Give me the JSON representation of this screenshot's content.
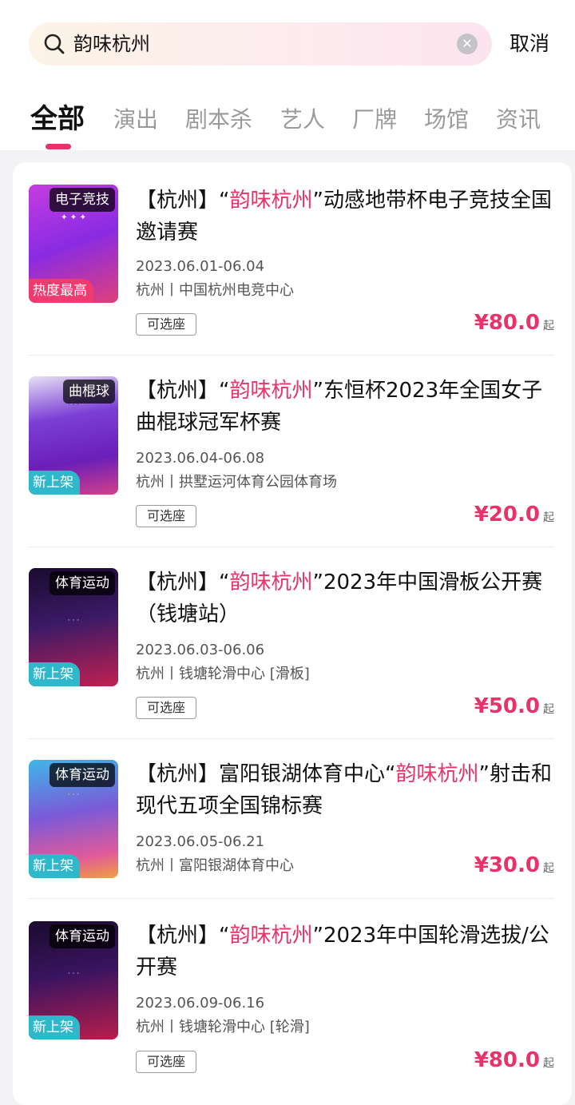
{
  "search": {
    "query": "韵味杭州",
    "cancel_label": "取消"
  },
  "tabs": [
    "全部",
    "演出",
    "剧本杀",
    "艺人",
    "厂牌",
    "场馆",
    "资讯"
  ],
  "colors": {
    "accent": "#e8326a",
    "hot_badge": "#ef3b6f",
    "new_badge": "#2fb8c9"
  },
  "results": [
    {
      "tag": "电子竞技",
      "badge": "热度最高",
      "title_pre": "【杭州】“",
      "title_hl": "韵味杭州",
      "title_post": "”动感地带杯电子竞技全国邀请赛",
      "date": "2023.06.01-06.04",
      "venue": "杭州丨中国杭州电竞中心",
      "seat_label": "可选座",
      "price": "¥80.0",
      "price_suffix": "起"
    },
    {
      "tag": "曲棍球",
      "badge": "新上架",
      "title_pre": "【杭州】“",
      "title_hl": "韵味杭州",
      "title_post": "”东恒杯2023年全国女子曲棍球冠军杯赛",
      "date": "2023.06.04-06.08",
      "venue": "杭州丨拱墅运河体育公园体育场",
      "seat_label": "可选座",
      "price": "¥20.0",
      "price_suffix": "起"
    },
    {
      "tag": "体育运动",
      "badge": "新上架",
      "title_pre": "【杭州】“",
      "title_hl": "韵味杭州",
      "title_post": "”2023年中国滑板公开赛（钱塘站）",
      "date": "2023.06.03-06.06",
      "venue": "杭州丨钱塘轮滑中心 [滑板]",
      "seat_label": "可选座",
      "price": "¥50.0",
      "price_suffix": "起"
    },
    {
      "tag": "体育运动",
      "badge": "新上架",
      "title_pre": "【杭州】富阳银湖体育中心“",
      "title_hl": "韵味杭州",
      "title_post": "”射击和现代五项全国锦标赛",
      "date": "2023.06.05-06.21",
      "venue": "杭州丨富阳银湖体育中心",
      "seat_label": "",
      "price": "¥30.0",
      "price_suffix": "起"
    },
    {
      "tag": "体育运动",
      "badge": "新上架",
      "title_pre": "【杭州】“",
      "title_hl": "韵味杭州",
      "title_post": "”2023年中国轮滑选拔/公开赛",
      "date": "2023.06.09-06.16",
      "venue": "杭州丨钱塘轮滑中心 [轮滑]",
      "seat_label": "可选座",
      "price": "¥80.0",
      "price_suffix": "起"
    }
  ]
}
